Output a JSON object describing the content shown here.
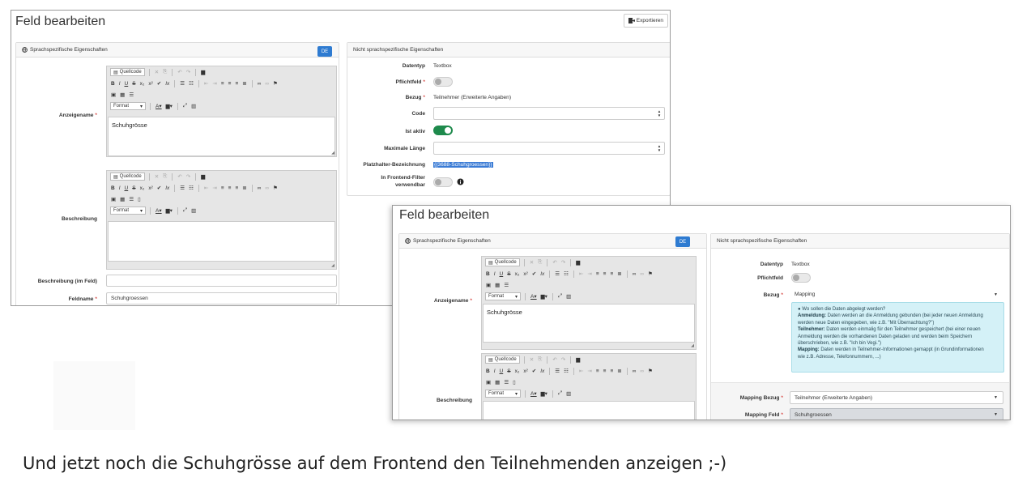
{
  "screen1": {
    "title": "Feld bearbeiten",
    "export_label": "Exportieren",
    "left_panel": {
      "title": "Sprachspezifische Eigenschaften",
      "lang_badge": "DE",
      "display_name_label": "Anzeigename",
      "display_name_value": "Schuhgrösse",
      "description_label": "Beschreibung",
      "description_in_field_label": "Beschreibung (im Feld)",
      "field_name_label": "Feldname",
      "field_name_value": "Schuhgroessen",
      "toolbar_source": "Quellcode",
      "toolbar_format": "Format"
    },
    "right_panel": {
      "title": "Nicht sprachspezifische Eigenschaften",
      "datatype_label": "Datentyp",
      "datatype_value": "Textbox",
      "required_label": "Pflichtfeld",
      "relation_label": "Bezug",
      "relation_value": "Teilnehmer (Erweiterte Angaben)",
      "code_label": "Code",
      "active_label": "Ist aktiv",
      "maxlength_label": "Maximale Länge",
      "placeholder_label": "Platzhalter-Bezeichnung",
      "placeholder_value": "{{3688-Schuhgroessen}}",
      "frontend_filter_label_1": "In Frontend-Filter",
      "frontend_filter_label_2": "verwendbar"
    }
  },
  "screen2": {
    "title": "Feld bearbeiten",
    "left_panel": {
      "title": "Sprachspezifische Eigenschaften",
      "lang_badge": "DE",
      "display_name_label": "Anzeigename",
      "display_name_value": "Schuhgrösse",
      "description_label": "Beschreibung",
      "toolbar_source": "Quellcode",
      "toolbar_format": "Format"
    },
    "right_panel": {
      "title": "Nicht sprachspezifische Eigenschaften",
      "datatype_label": "Datentyp",
      "datatype_value": "Textbox",
      "required_label": "Pflichtfeld",
      "relation_label": "Bezug",
      "relation_value": "Mapping",
      "info_question": "Wo sollen die Daten abgelegt werden?",
      "info_anmeldung_term": "Anmeldung:",
      "info_anmeldung_text_1": "Daten werden an die Anmeldung gebunden (bei jeder neuen Anmeldung",
      "info_anmeldung_text_2": "werden neue Daten eingegeben, wie z.B. \"Mit Übernachtung?\")",
      "info_teilnehmer_term": "Teilnehmer:",
      "info_teilnehmer_text_1": "Daten werden einmalig für den Teilnehmer gespeichert (bei einer neuen",
      "info_teilnehmer_text_2": "Anmeldung werden die vorhandenen Daten geladen und werden beim Speichern",
      "info_teilnehmer_text_3": "überschrieben, wie z.B. \"Ich bin Vegi.\")",
      "info_mapping_term": "Mapping:",
      "info_mapping_text_1": "Daten werden in Teilnehmer-Informationen gemappt (in Grundinformationen",
      "info_mapping_text_2": "wie z.B. Adresse, Telefonnummern, ...)",
      "mapping_relation_label": "Mapping Bezug",
      "mapping_relation_value": "Teilnehmer (Erweiterte Angaben)",
      "mapping_field_label": "Mapping Feld",
      "mapping_field_value": "Schuhgroessen"
    }
  },
  "caption": "Und jetzt noch die Schuhgrösse auf dem Frontend den Teilnehmenden anzeigen ;-)"
}
